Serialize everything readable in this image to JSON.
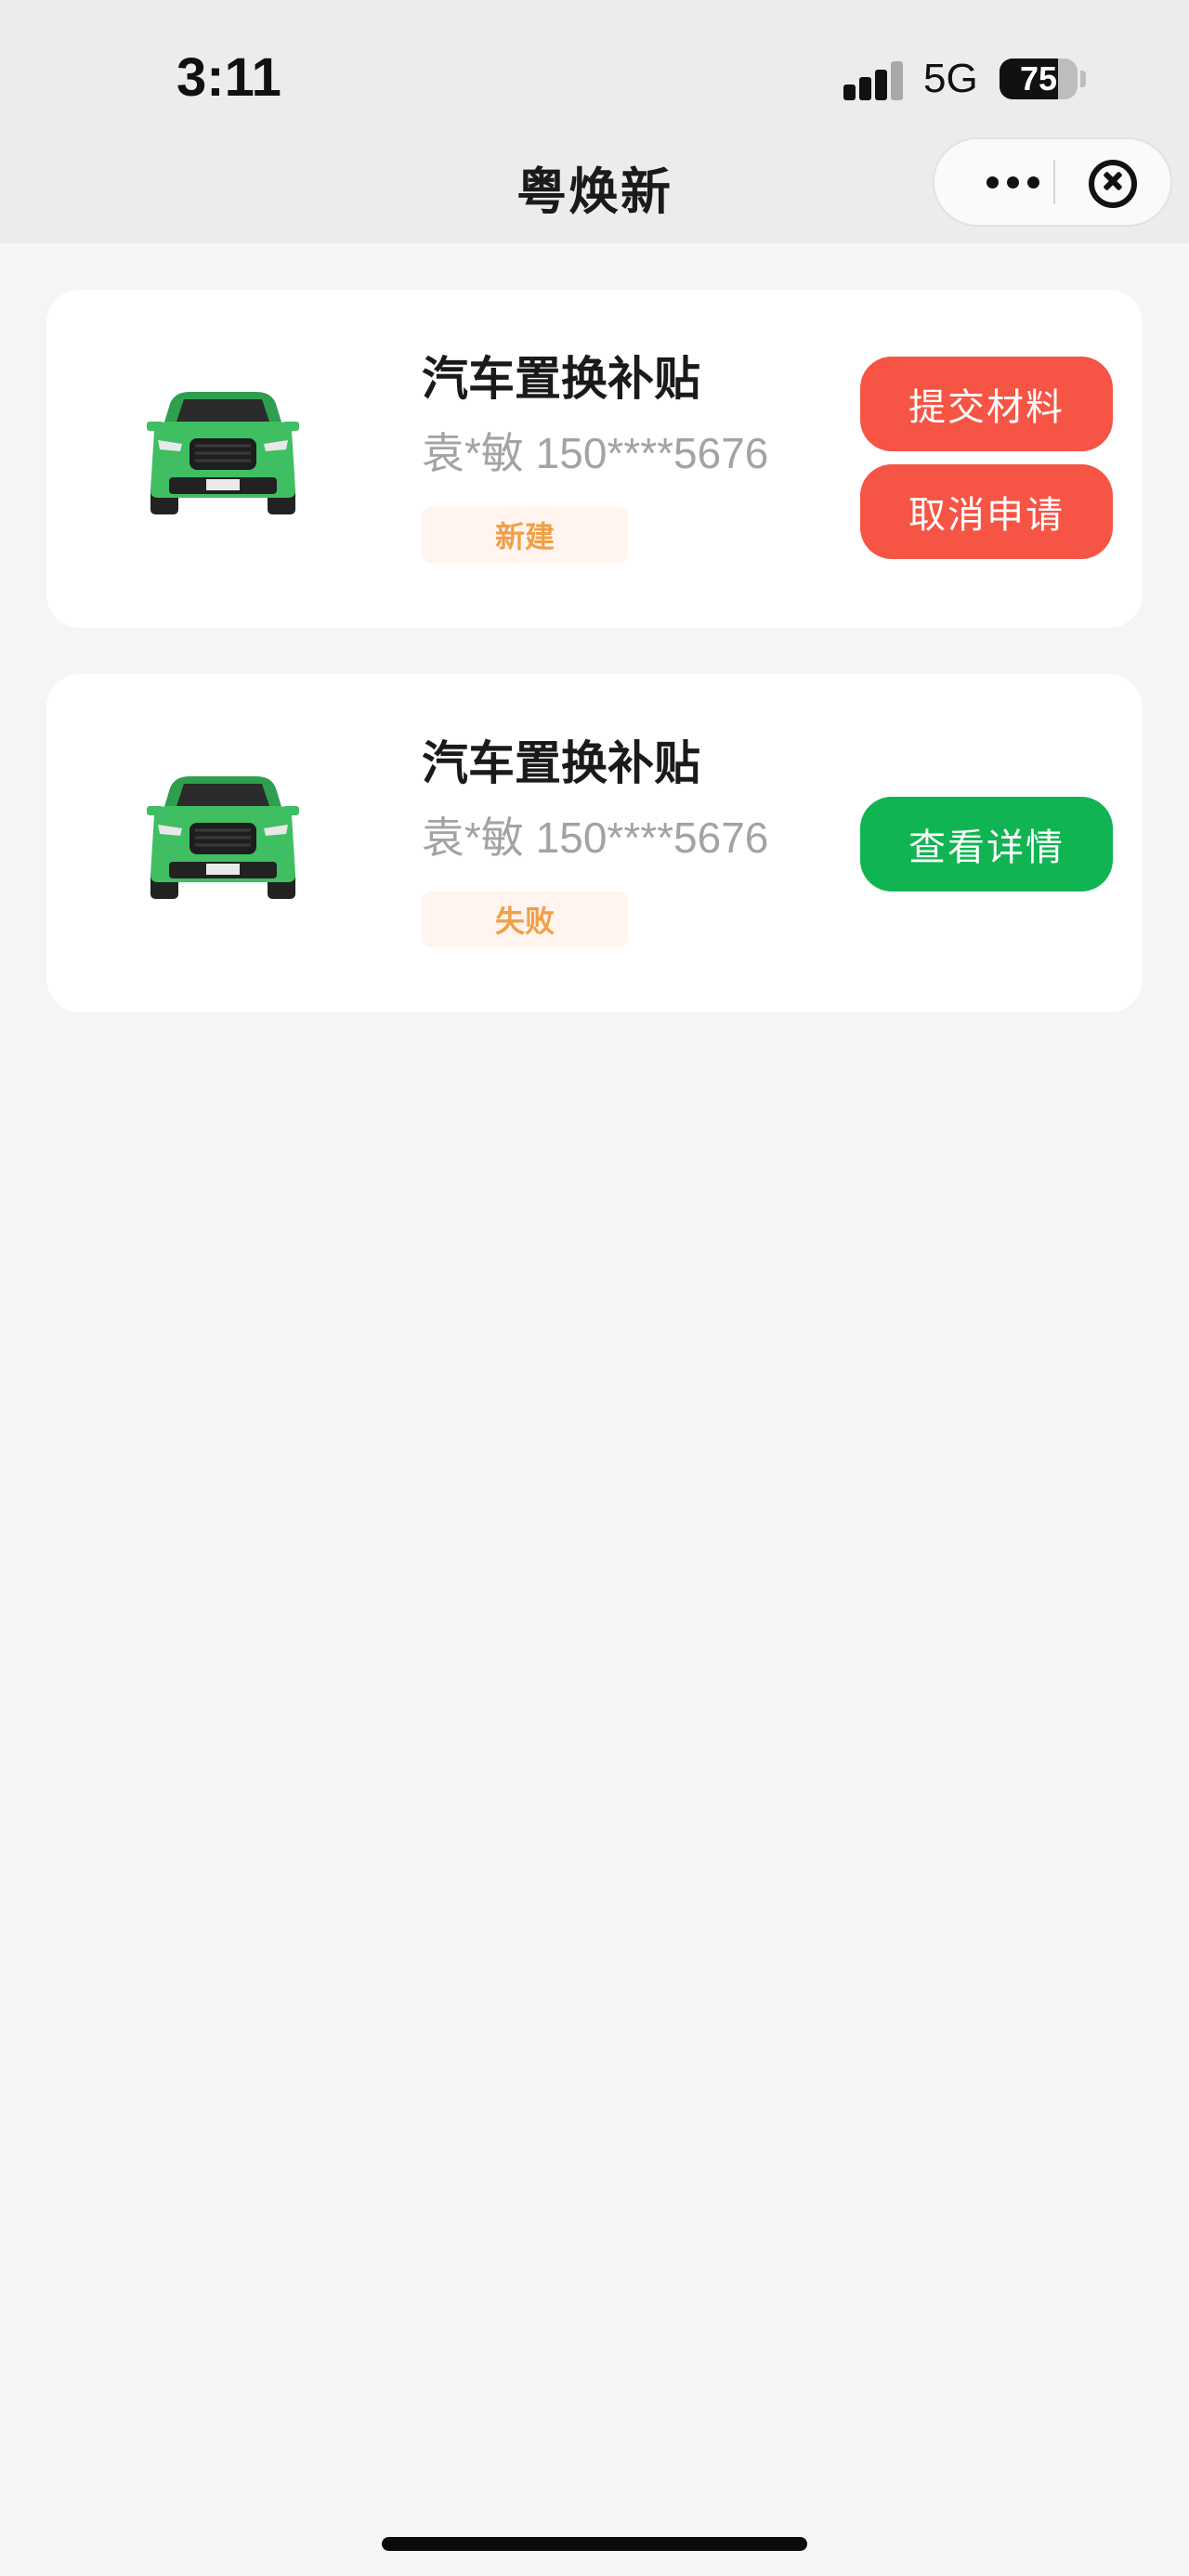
{
  "status_bar": {
    "time": "3:11",
    "network": "5G",
    "battery_percent": "75",
    "battery_level": 0.75,
    "signal_bars_active": 3
  },
  "header": {
    "title": "粤焕新",
    "more_icon": "more-dots-icon",
    "close_icon": "close-circle-icon"
  },
  "cards": [
    {
      "title": "汽车置换补贴",
      "contact": "袁*敏 150****5676",
      "status": "新建",
      "buttons": [
        "提交材料",
        "取消申请"
      ]
    },
    {
      "title": "汽车置换补贴",
      "contact": "袁*敏 150****5676",
      "status": "失败",
      "buttons": [
        "查看详情"
      ]
    }
  ],
  "colors": {
    "background": "#f5f5f5",
    "header_bg": "#ececec",
    "card_bg": "#ffffff",
    "button_red": "#f65445",
    "button_green": "#11b452",
    "status_text": "#f0a048",
    "status_bg": "#fff4ee",
    "car_green": "#3fbe62"
  }
}
